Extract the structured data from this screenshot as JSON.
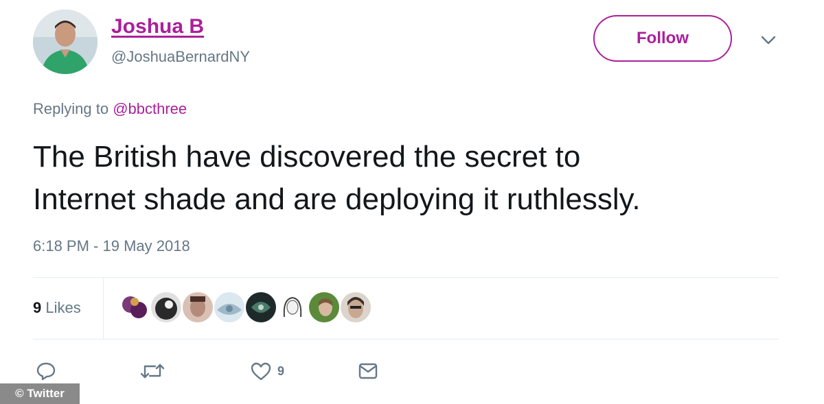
{
  "user": {
    "display_name": "Joshua B",
    "handle": "@JoshuaBernardNY",
    "avatar_icon": "profile-photo"
  },
  "follow_button": {
    "label": "Follow"
  },
  "menu": {
    "icon": "chevron-down-icon"
  },
  "reply_context": {
    "prefix": "Replying to",
    "mention": "@bbcthree"
  },
  "tweet": {
    "line1": "The British have discovered the secret to",
    "line2": "Internet shade and are deploying it ruthlessly."
  },
  "timestamp": "6:18 PM - 19 May 2018",
  "stats": {
    "likes_count": "9",
    "likes_label": "Likes"
  },
  "likers": [
    {
      "name": "liker-1",
      "color": "#7a3a7a"
    },
    {
      "name": "liker-2",
      "color": "#2a2a2a"
    },
    {
      "name": "liker-3",
      "color": "#b48a7a"
    },
    {
      "name": "liker-4",
      "color": "#9fb8c8"
    },
    {
      "name": "liker-5",
      "color": "#4a7a6a"
    },
    {
      "name": "liker-6",
      "color": "#e8e8e8"
    },
    {
      "name": "liker-7",
      "color": "#5a8a3a"
    },
    {
      "name": "liker-8",
      "color": "#6a5a50"
    }
  ],
  "actions": {
    "reply_icon": "reply-icon",
    "retweet_icon": "retweet-icon",
    "like_icon": "heart-icon",
    "like_count": "9",
    "dm_icon": "envelope-icon"
  },
  "watermark": "© Twitter",
  "colors": {
    "accent": "#ab1f9b",
    "secondary_text": "#657786",
    "primary_text": "#14171a"
  }
}
